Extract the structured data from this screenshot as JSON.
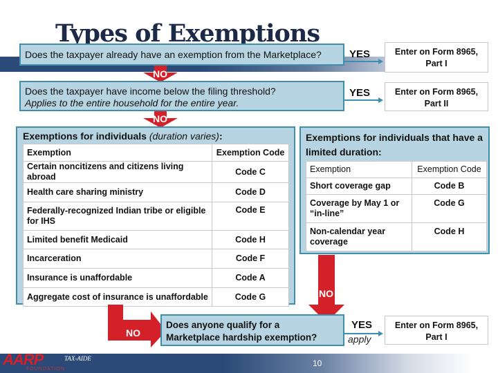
{
  "title": "Types of Exemptions",
  "q1": {
    "text": "Does the taxpayer already have an exemption from the Marketplace?",
    "yes_label": "YES",
    "result": [
      "Enter on Form 8965,",
      "Part I"
    ],
    "no_label": "NO"
  },
  "q2": {
    "text": "Does the taxpayer have income below the filing threshold?",
    "note": "Applies to the entire household for the entire year.",
    "yes_label": "YES",
    "result": [
      "Enter on Form 8965,",
      "Part II"
    ],
    "no_label": "NO"
  },
  "individuals": {
    "title_bold": "Exemptions for individuals",
    "title_italic": "(duration varies)",
    "title_suffix": ":",
    "headers": [
      "Exemption",
      "Exemption Code"
    ],
    "rows": [
      [
        "Certain noncitizens and citizens living abroad",
        "Code C"
      ],
      [
        "Health care sharing ministry",
        "Code D"
      ],
      [
        "Federally-recognized Indian tribe or eligible for IHS",
        "Code E"
      ],
      [
        "Limited benefit Medicaid",
        "Code H"
      ],
      [
        "Incarceration",
        "Code F"
      ],
      [
        "Insurance is unaffordable",
        "Code A"
      ],
      [
        "Aggregate cost of insurance is unaffordable",
        "Code G"
      ]
    ]
  },
  "limited": {
    "title": "Exemptions for individuals that have a limited duration:",
    "headers": [
      "Exemption",
      "Exemption Code"
    ],
    "rows": [
      [
        "Short coverage gap",
        "Code B"
      ],
      [
        "Coverage by May 1 or “in-line”",
        "Code G"
      ],
      [
        "Non-calendar year coverage",
        "Code H"
      ]
    ]
  },
  "q3": {
    "text_line1": "Does anyone qualify for a",
    "text_line2": "Marketplace hardship exemption?",
    "yes_label": "YES",
    "apply_label": "apply",
    "result": [
      "Enter on Form 8965,",
      "Part I"
    ],
    "no_left_label": "NO",
    "no_right_label": "NO"
  },
  "footer": {
    "logo_text": "AARP",
    "logo_sub": "FOUNDATION",
    "program": "TAX-AIDE",
    "page_number": "10"
  },
  "colors": {
    "question_fill": "#b6d4e1",
    "question_border": "#3f8eaa",
    "no_arrow": "#d42029",
    "navy": "#2b4a78"
  }
}
